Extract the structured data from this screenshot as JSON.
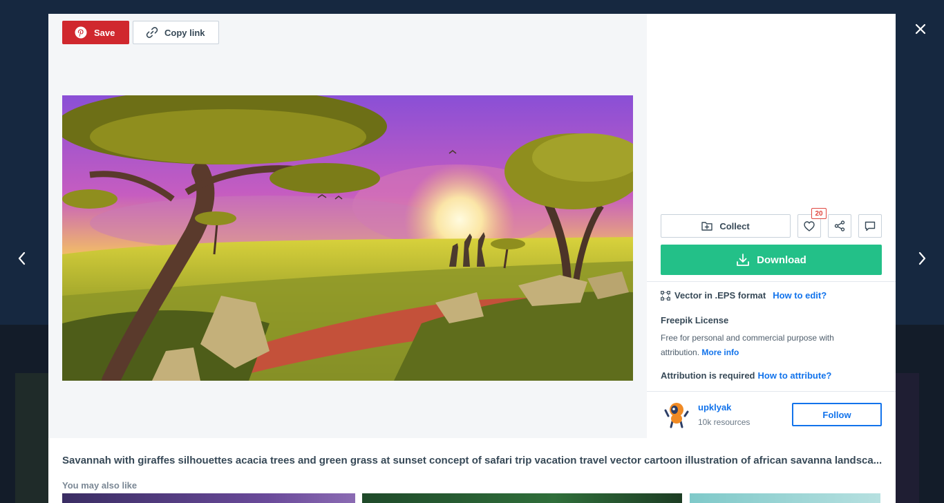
{
  "toolbar": {
    "save_label": "Save",
    "copy_link_label": "Copy link"
  },
  "actions": {
    "collect_label": "Collect",
    "like_count": "20",
    "download_label": "Download"
  },
  "info": {
    "format_text": "Vector in .EPS format",
    "how_to_edit": "How to edit?",
    "license_title": "Freepik License",
    "license_text": "Free for personal and commercial purpose with attribution.",
    "more_info": "More info",
    "attribution_text": "Attribution is required",
    "how_to_attribute": "How to attribute?"
  },
  "author": {
    "name": "upklyak",
    "resources": "10k resources",
    "follow_label": "Follow"
  },
  "resource": {
    "title": "Savannah with giraffes silhouettes acacia trees and green grass at sunset concept of safari trip vacation travel vector cartoon illustration of african savanna landsca..."
  },
  "related": {
    "label": "You may also like"
  },
  "colors": {
    "save_red": "#d0282e",
    "download_green": "#23c088",
    "link_blue": "#1273eb",
    "badge_red": "#e0453e"
  },
  "icons": {
    "save": "pinterest-icon",
    "copy_link": "link-icon",
    "collect": "folder-plus-icon",
    "like": "heart-icon",
    "share": "share-icon",
    "comment": "comment-icon",
    "download": "download-icon",
    "format": "vector-icon",
    "close": "close-icon",
    "prev": "chevron-left-icon",
    "next": "chevron-right-icon"
  }
}
